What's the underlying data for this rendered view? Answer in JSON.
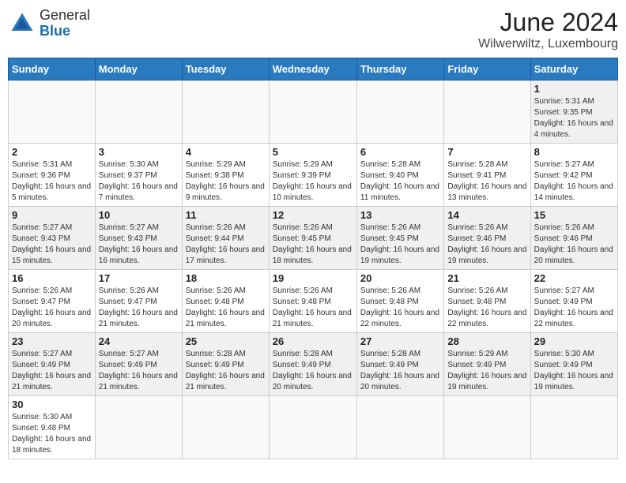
{
  "header": {
    "logo_general": "General",
    "logo_blue": "Blue",
    "month_year": "June 2024",
    "location": "Wilwerwiltz, Luxembourg"
  },
  "days_of_week": [
    "Sunday",
    "Monday",
    "Tuesday",
    "Wednesday",
    "Thursday",
    "Friday",
    "Saturday"
  ],
  "weeks": [
    {
      "days": [
        {
          "number": "",
          "info": ""
        },
        {
          "number": "",
          "info": ""
        },
        {
          "number": "",
          "info": ""
        },
        {
          "number": "",
          "info": ""
        },
        {
          "number": "",
          "info": ""
        },
        {
          "number": "",
          "info": ""
        },
        {
          "number": "1",
          "info": "Sunrise: 5:31 AM\nSunset: 9:35 PM\nDaylight: 16 hours and 4 minutes."
        }
      ]
    },
    {
      "days": [
        {
          "number": "2",
          "info": "Sunrise: 5:31 AM\nSunset: 9:36 PM\nDaylight: 16 hours and 5 minutes."
        },
        {
          "number": "3",
          "info": "Sunrise: 5:30 AM\nSunset: 9:37 PM\nDaylight: 16 hours and 7 minutes."
        },
        {
          "number": "4",
          "info": "Sunrise: 5:29 AM\nSunset: 9:38 PM\nDaylight: 16 hours and 9 minutes."
        },
        {
          "number": "5",
          "info": "Sunrise: 5:29 AM\nSunset: 9:39 PM\nDaylight: 16 hours and 10 minutes."
        },
        {
          "number": "6",
          "info": "Sunrise: 5:28 AM\nSunset: 9:40 PM\nDaylight: 16 hours and 11 minutes."
        },
        {
          "number": "7",
          "info": "Sunrise: 5:28 AM\nSunset: 9:41 PM\nDaylight: 16 hours and 13 minutes."
        },
        {
          "number": "8",
          "info": "Sunrise: 5:27 AM\nSunset: 9:42 PM\nDaylight: 16 hours and 14 minutes."
        }
      ]
    },
    {
      "days": [
        {
          "number": "9",
          "info": "Sunrise: 5:27 AM\nSunset: 9:43 PM\nDaylight: 16 hours and 15 minutes."
        },
        {
          "number": "10",
          "info": "Sunrise: 5:27 AM\nSunset: 9:43 PM\nDaylight: 16 hours and 16 minutes."
        },
        {
          "number": "11",
          "info": "Sunrise: 5:26 AM\nSunset: 9:44 PM\nDaylight: 16 hours and 17 minutes."
        },
        {
          "number": "12",
          "info": "Sunrise: 5:26 AM\nSunset: 9:45 PM\nDaylight: 16 hours and 18 minutes."
        },
        {
          "number": "13",
          "info": "Sunrise: 5:26 AM\nSunset: 9:45 PM\nDaylight: 16 hours and 19 minutes."
        },
        {
          "number": "14",
          "info": "Sunrise: 5:26 AM\nSunset: 9:46 PM\nDaylight: 16 hours and 19 minutes."
        },
        {
          "number": "15",
          "info": "Sunrise: 5:26 AM\nSunset: 9:46 PM\nDaylight: 16 hours and 20 minutes."
        }
      ]
    },
    {
      "days": [
        {
          "number": "16",
          "info": "Sunrise: 5:26 AM\nSunset: 9:47 PM\nDaylight: 16 hours and 20 minutes."
        },
        {
          "number": "17",
          "info": "Sunrise: 5:26 AM\nSunset: 9:47 PM\nDaylight: 16 hours and 21 minutes."
        },
        {
          "number": "18",
          "info": "Sunrise: 5:26 AM\nSunset: 9:48 PM\nDaylight: 16 hours and 21 minutes."
        },
        {
          "number": "19",
          "info": "Sunrise: 5:26 AM\nSunset: 9:48 PM\nDaylight: 16 hours and 21 minutes."
        },
        {
          "number": "20",
          "info": "Sunrise: 5:26 AM\nSunset: 9:48 PM\nDaylight: 16 hours and 22 minutes."
        },
        {
          "number": "21",
          "info": "Sunrise: 5:26 AM\nSunset: 9:48 PM\nDaylight: 16 hours and 22 minutes."
        },
        {
          "number": "22",
          "info": "Sunrise: 5:27 AM\nSunset: 9:49 PM\nDaylight: 16 hours and 22 minutes."
        }
      ]
    },
    {
      "days": [
        {
          "number": "23",
          "info": "Sunrise: 5:27 AM\nSunset: 9:49 PM\nDaylight: 16 hours and 21 minutes."
        },
        {
          "number": "24",
          "info": "Sunrise: 5:27 AM\nSunset: 9:49 PM\nDaylight: 16 hours and 21 minutes."
        },
        {
          "number": "25",
          "info": "Sunrise: 5:28 AM\nSunset: 9:49 PM\nDaylight: 16 hours and 21 minutes."
        },
        {
          "number": "26",
          "info": "Sunrise: 5:28 AM\nSunset: 9:49 PM\nDaylight: 16 hours and 20 minutes."
        },
        {
          "number": "27",
          "info": "Sunrise: 5:28 AM\nSunset: 9:49 PM\nDaylight: 16 hours and 20 minutes."
        },
        {
          "number": "28",
          "info": "Sunrise: 5:29 AM\nSunset: 9:49 PM\nDaylight: 16 hours and 19 minutes."
        },
        {
          "number": "29",
          "info": "Sunrise: 5:30 AM\nSunset: 9:49 PM\nDaylight: 16 hours and 19 minutes."
        }
      ]
    },
    {
      "days": [
        {
          "number": "30",
          "info": "Sunrise: 5:30 AM\nSunset: 9:48 PM\nDaylight: 16 hours and 18 minutes."
        },
        {
          "number": "",
          "info": ""
        },
        {
          "number": "",
          "info": ""
        },
        {
          "number": "",
          "info": ""
        },
        {
          "number": "",
          "info": ""
        },
        {
          "number": "",
          "info": ""
        },
        {
          "number": "",
          "info": ""
        }
      ]
    }
  ]
}
